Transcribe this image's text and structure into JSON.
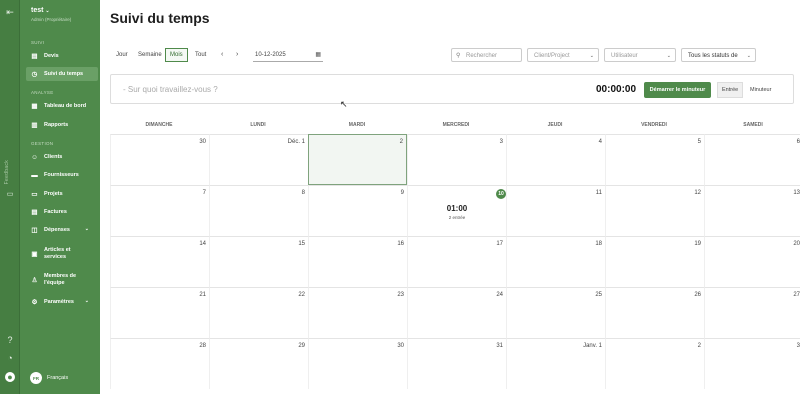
{
  "app": {
    "workspace": "test",
    "workspace_sub": "Admin (Propriétaire)",
    "collapse_icon": "sidebar-collapse-icon",
    "rail_label": "Feedback"
  },
  "sidebar": {
    "sections": [
      {
        "label": "SUIVI",
        "items": [
          {
            "label": "Devis",
            "icon": "quote-icon"
          },
          {
            "label": "Suivi du temps",
            "icon": "clock-icon",
            "active": true
          }
        ]
      },
      {
        "label": "ANALYSE",
        "items": [
          {
            "label": "Tableau de bord",
            "icon": "dashboard-icon"
          },
          {
            "label": "Rapports",
            "icon": "chart-icon"
          }
        ]
      },
      {
        "label": "GESTION",
        "items": [
          {
            "label": "Clients",
            "icon": "users-icon"
          },
          {
            "label": "Fournisseurs",
            "icon": "truck-icon"
          },
          {
            "label": "Projets",
            "icon": "folder-icon"
          },
          {
            "label": "Factures",
            "icon": "invoice-icon"
          },
          {
            "label": "Dépenses",
            "icon": "wallet-icon",
            "expandable": true
          },
          {
            "label": "Articles et services",
            "icon": "box-icon"
          },
          {
            "label": "Membres de l'équipe",
            "icon": "team-icon"
          },
          {
            "label": "Paramètres",
            "icon": "gear-icon",
            "expandable": true
          }
        ]
      }
    ],
    "language": {
      "code": "FR",
      "label": "Français"
    }
  },
  "page": {
    "title": "Suivi du temps"
  },
  "toolbar": {
    "views": [
      "Jour",
      "Semaine",
      "Mois",
      "Tout"
    ],
    "active_view": "Mois",
    "date_value": "10-12-2025",
    "search_placeholder": "Rechercher",
    "client_placeholder": "Client/Project",
    "user_placeholder": "Utilisateur",
    "status_value": "Tous les statuts de"
  },
  "timer": {
    "placeholder": "- Sur quoi travaillez-vous ?",
    "time": "00:00:00",
    "start_label": "Démarrer le minuteur",
    "modes": [
      "Entrée",
      "Minuteur"
    ],
    "active_mode": "Entrée"
  },
  "calendar": {
    "weekdays": [
      "DIMANCHE",
      "LUNDI",
      "MARDI",
      "MERCREDI",
      "JEUDI",
      "VENDREDI",
      "SAMEDI"
    ],
    "weeks": [
      [
        "30",
        "Déc. 1",
        "2",
        "3",
        "4",
        "5",
        "6"
      ],
      [
        "7",
        "8",
        "9",
        "10",
        "11",
        "12",
        "13"
      ],
      [
        "14",
        "15",
        "16",
        "17",
        "18",
        "19",
        "20"
      ],
      [
        "21",
        "22",
        "23",
        "24",
        "25",
        "26",
        "27"
      ],
      [
        "28",
        "29",
        "30",
        "31",
        "Janv. 1",
        "2",
        "3"
      ]
    ],
    "today": "10",
    "selected": "2",
    "entry": {
      "day": "10",
      "time": "01:00",
      "count": "2 entrée"
    }
  }
}
